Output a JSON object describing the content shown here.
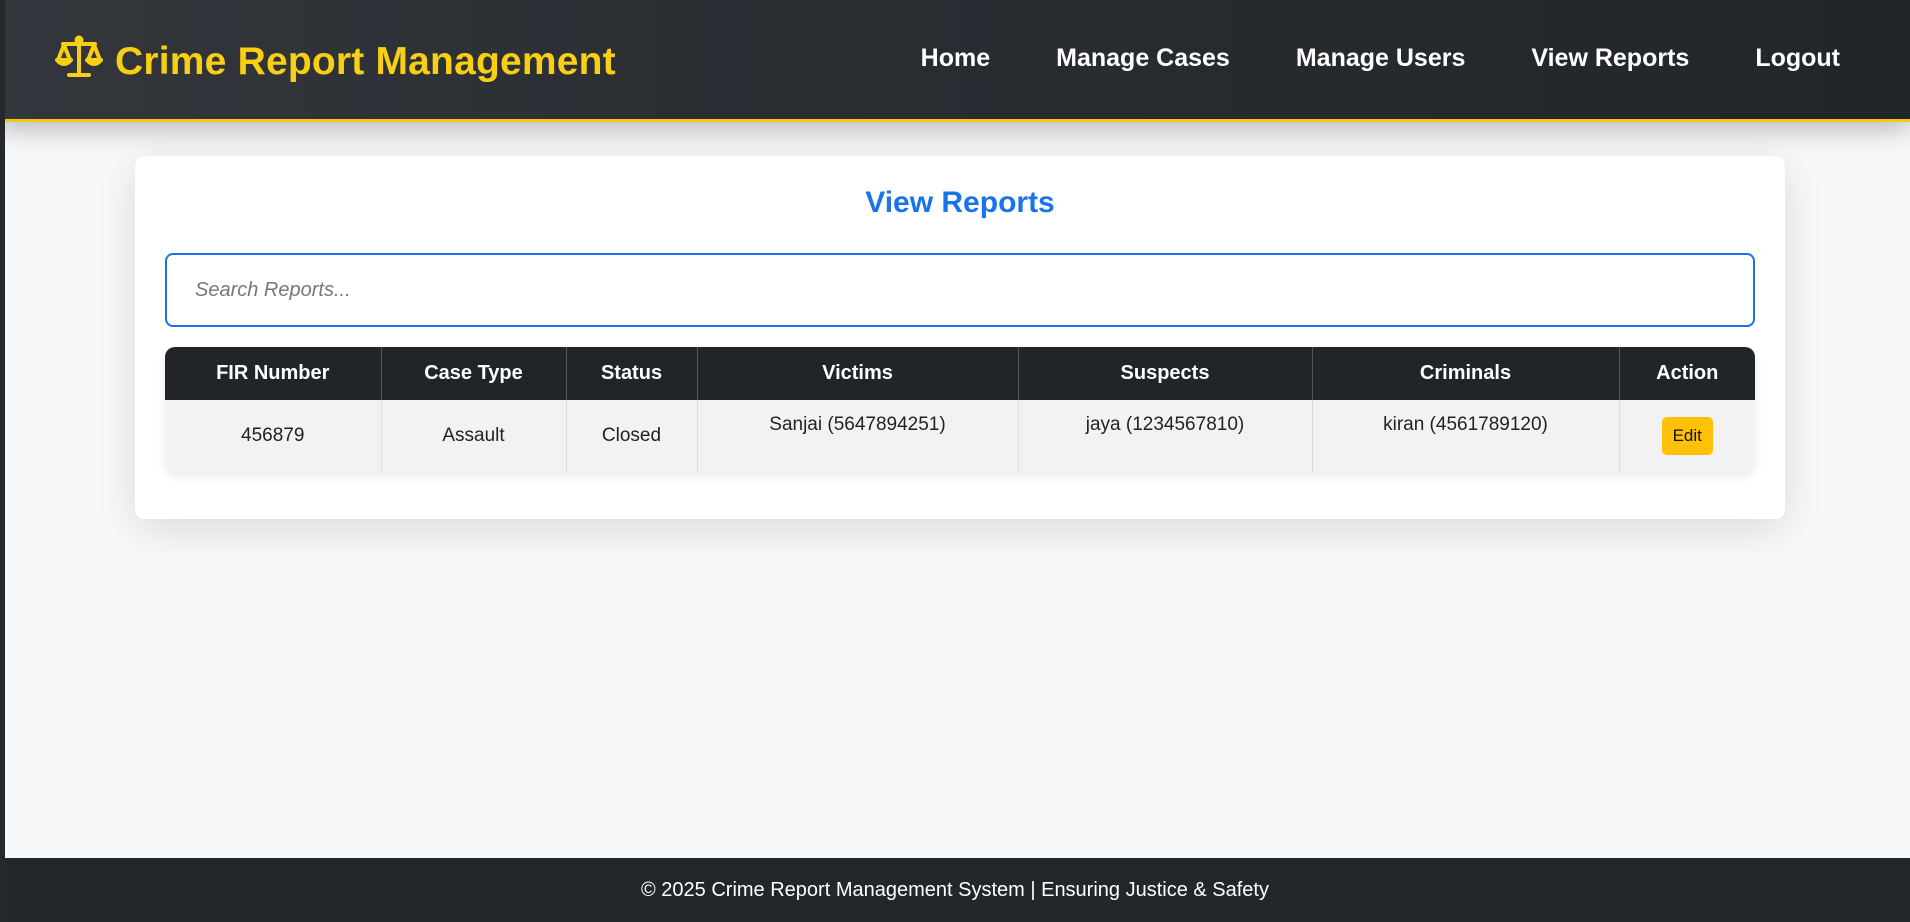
{
  "brand": {
    "title": "Crime Report Management",
    "icon": "scales-icon",
    "color": "#f9cf14"
  },
  "nav": {
    "items": [
      {
        "label": "Home"
      },
      {
        "label": "Manage Cases"
      },
      {
        "label": "Manage Users"
      },
      {
        "label": "View Reports"
      },
      {
        "label": "Logout"
      }
    ]
  },
  "main": {
    "title": "View Reports",
    "search": {
      "placeholder": "Search Reports...",
      "value": ""
    },
    "table": {
      "headers": [
        "FIR Number",
        "Case Type",
        "Status",
        "Victims",
        "Suspects",
        "Criminals",
        "Action"
      ],
      "rows": [
        {
          "fir": "456879",
          "case_type": "Assault",
          "status": "Closed",
          "victims": "Sanjai (5647894251)",
          "suspects": "jaya (1234567810)",
          "criminals": "kiran (4561789120)",
          "action": "Edit"
        }
      ]
    }
  },
  "footer": {
    "text": "© 2025 Crime Report Management System | Ensuring Justice & Safety"
  },
  "colors": {
    "accent": "#1a73e8",
    "brand_yellow": "#f9cf14",
    "edit_button": "#ffc107",
    "dark": "#212529"
  }
}
